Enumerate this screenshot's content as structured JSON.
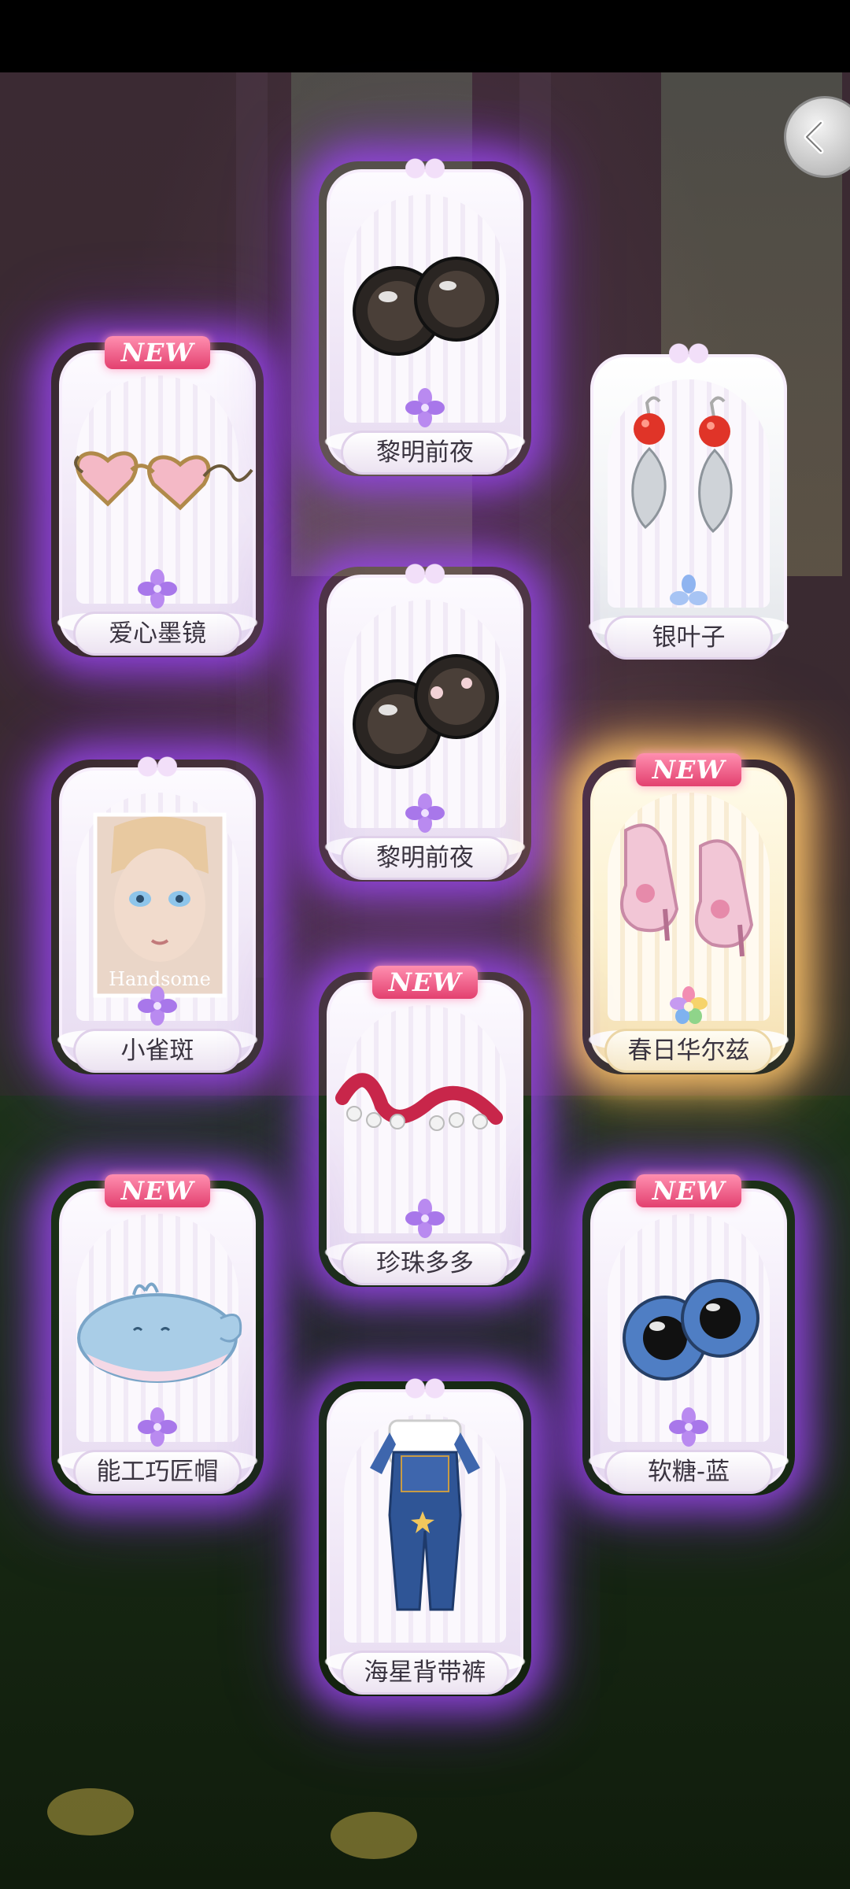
{
  "screen": {
    "type": "gacha-reward-results",
    "accent_purple": "#9b4be6",
    "accent_gold": "#f6c86e",
    "badge_color": "#e3406f"
  },
  "header": {
    "back_button_icon": "chevron-left-icon"
  },
  "rewards": [
    {
      "name": "爱心墨镜",
      "is_new": true,
      "rarity": "purple",
      "icon": "heart-sunglasses-icon",
      "badge": "NEW"
    },
    {
      "name": "黎明前夜",
      "is_new": false,
      "rarity": "purple",
      "icon": "dark-eyes-icon"
    },
    {
      "name": "银叶子",
      "is_new": false,
      "rarity": "white",
      "icon": "silver-leaf-earrings-icon"
    },
    {
      "name": "黎明前夜",
      "is_new": false,
      "rarity": "purple",
      "icon": "dark-eyes-flower-icon"
    },
    {
      "name": "小雀斑",
      "is_new": false,
      "rarity": "purple",
      "icon": "freckles-portrait-icon",
      "portrait_caption": "Handsome"
    },
    {
      "name": "春日华尔兹",
      "is_new": true,
      "rarity": "gold",
      "icon": "pink-heels-icon",
      "badge": "NEW"
    },
    {
      "name": "珍珠多多",
      "is_new": true,
      "rarity": "purple",
      "icon": "pearl-ribbon-icon",
      "badge": "NEW"
    },
    {
      "name": "能工巧匠帽",
      "is_new": true,
      "rarity": "purple",
      "icon": "whale-beret-icon",
      "badge": "NEW"
    },
    {
      "name": "软糖-蓝",
      "is_new": true,
      "rarity": "purple",
      "icon": "blue-eyes-icon",
      "badge": "NEW"
    },
    {
      "name": "海星背带裤",
      "is_new": false,
      "rarity": "purple",
      "icon": "denim-overalls-icon"
    }
  ]
}
